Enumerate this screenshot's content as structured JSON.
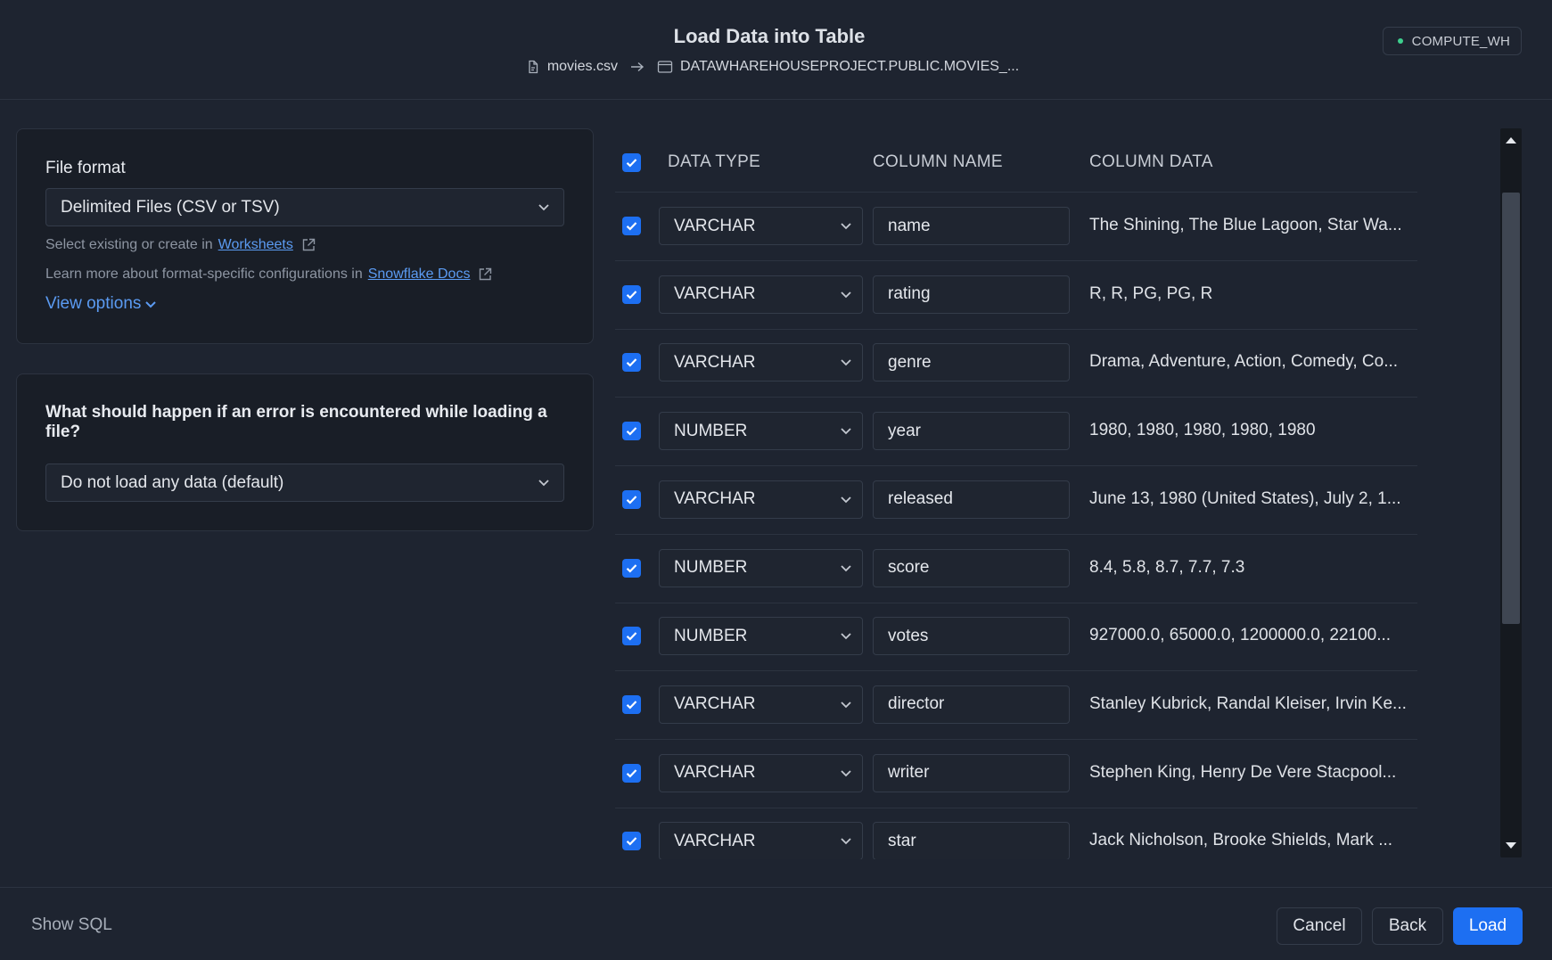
{
  "header": {
    "title": "Load Data into Table",
    "source_file": "movies.csv",
    "target_table": "DATAWHAREHOUSEPROJECT.PUBLIC.MOVIES_...",
    "warehouse": "COMPUTE_WH"
  },
  "file_format": {
    "label": "File format",
    "selected": "Delimited Files (CSV or TSV)",
    "hint1_prefix": "Select existing or create in",
    "hint1_link": "Worksheets",
    "hint2_prefix": "Learn more about format-specific configurations in",
    "hint2_link": "Snowflake Docs",
    "view_options": "View options"
  },
  "error_handling": {
    "question": "What should happen if an error is encountered while loading a file?",
    "selected": "Do not load any data (default)"
  },
  "table": {
    "headers": {
      "data_type": "DATA TYPE",
      "column_name": "COLUMN NAME",
      "column_data": "COLUMN DATA"
    },
    "rows": [
      {
        "type": "VARCHAR",
        "name": "name",
        "data": "The Shining, The Blue Lagoon, Star Wa..."
      },
      {
        "type": "VARCHAR",
        "name": "rating",
        "data": "R, R, PG, PG, R"
      },
      {
        "type": "VARCHAR",
        "name": "genre",
        "data": "Drama, Adventure, Action, Comedy, Co..."
      },
      {
        "type": "NUMBER",
        "name": "year",
        "data": "1980, 1980, 1980, 1980, 1980"
      },
      {
        "type": "VARCHAR",
        "name": "released",
        "data": "June 13, 1980 (United States), July 2, 1..."
      },
      {
        "type": "NUMBER",
        "name": "score",
        "data": "8.4, 5.8, 8.7, 7.7, 7.3"
      },
      {
        "type": "NUMBER",
        "name": "votes",
        "data": "927000.0, 65000.0, 1200000.0, 22100..."
      },
      {
        "type": "VARCHAR",
        "name": "director",
        "data": "Stanley Kubrick, Randal Kleiser, Irvin Ke..."
      },
      {
        "type": "VARCHAR",
        "name": "writer",
        "data": "Stephen King, Henry De Vere Stacpool..."
      },
      {
        "type": "VARCHAR",
        "name": "star",
        "data": "Jack Nicholson, Brooke Shields, Mark ..."
      }
    ]
  },
  "footer": {
    "show_sql": "Show SQL",
    "cancel": "Cancel",
    "back": "Back",
    "load": "Load"
  },
  "colors": {
    "accent": "#1d6ff2",
    "link": "#5b9bf2",
    "status_dot": "#3ecf8e"
  }
}
